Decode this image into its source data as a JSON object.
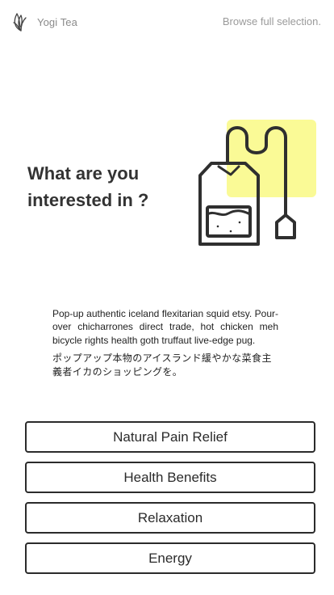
{
  "header": {
    "brand_name": "Yogi Tea",
    "logo_icon": "leaf-logo-icon",
    "browse_label": "Browse full selection."
  },
  "hero": {
    "headline_line1": "What are you",
    "headline_line2": "interested in ?",
    "illustration_icon": "tea-bag-icon",
    "accent_color": "#fafa96"
  },
  "intro": {
    "english": "Pop-up authentic iceland flexitarian squid etsy. Pour-over chicharrones direct trade, hot chicken meh bicycle rights health goth truffaut live-edge pug.",
    "japanese": "ポップアップ本物のアイスランド緩やかな菜食主義者イカのショッピングを。"
  },
  "options": [
    {
      "label": "Natural Pain Relief"
    },
    {
      "label": "Health Benefits"
    },
    {
      "label": "Relaxation"
    },
    {
      "label": "Energy"
    }
  ]
}
